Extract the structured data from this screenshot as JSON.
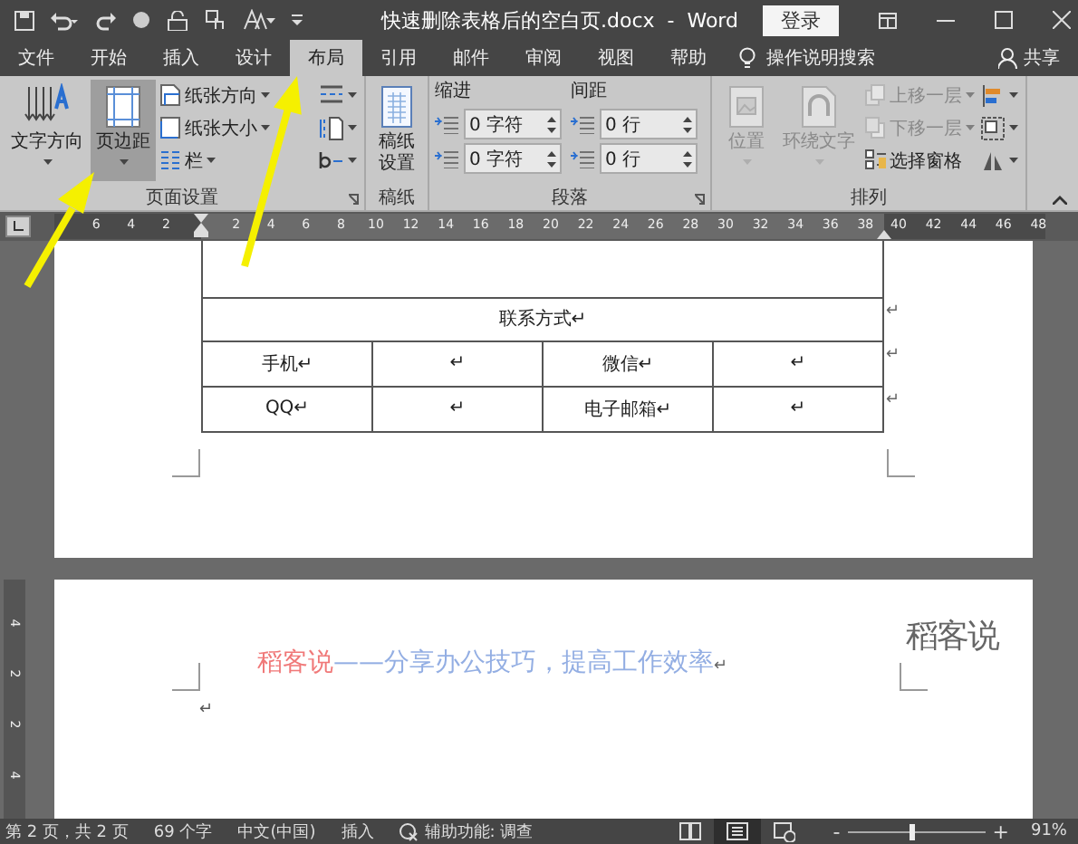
{
  "title_bar": {
    "title": "快速删除表格后的空白页.docx  -  Word",
    "login": "登录"
  },
  "tabs": [
    {
      "label": "文件",
      "selected": false
    },
    {
      "label": "开始",
      "selected": false
    },
    {
      "label": "插入",
      "selected": false
    },
    {
      "label": "设计",
      "selected": false
    },
    {
      "label": "布局",
      "selected": true
    },
    {
      "label": "引用",
      "selected": false
    },
    {
      "label": "邮件",
      "selected": false
    },
    {
      "label": "审阅",
      "selected": false
    },
    {
      "label": "视图",
      "selected": false
    },
    {
      "label": "帮助",
      "selected": false
    }
  ],
  "tell_me": "操作说明搜索",
  "share": "共享",
  "ribbon": {
    "groups": [
      {
        "label": "页面设置",
        "launcher": true,
        "controls": [
          {
            "kind": "large",
            "label": "文字方向",
            "dropdown": true,
            "hovered": false,
            "disabled": false
          },
          {
            "kind": "large",
            "label": "页边距",
            "dropdown": true,
            "hovered": true,
            "disabled": false
          },
          {
            "kind": "small",
            "label": "纸张方向",
            "dropdown": true,
            "hovered": false,
            "disabled": false
          },
          {
            "kind": "small",
            "label": "纸张大小",
            "dropdown": true,
            "hovered": false,
            "disabled": false
          },
          {
            "kind": "small",
            "label": "栏",
            "dropdown": true,
            "hovered": false,
            "disabled": false
          },
          {
            "kind": "icon",
            "dropdown": true,
            "hovered": false,
            "disabled": false
          },
          {
            "kind": "icon",
            "dropdown": true,
            "hovered": false,
            "disabled": false
          },
          {
            "kind": "icon",
            "dropdown": true,
            "hovered": false,
            "disabled": false
          }
        ]
      },
      {
        "label": "稿纸",
        "launcher": false,
        "controls": [
          {
            "kind": "large",
            "label": "稿纸设置",
            "dropdown": false,
            "hovered": false,
            "disabled": false
          }
        ]
      },
      {
        "label": "段落",
        "launcher": true,
        "controls": [
          {
            "kind": "spinners",
            "label": "缩进",
            "values": [
              "0 字符",
              "0 字符"
            ],
            "hovered": false,
            "disabled": false
          },
          {
            "kind": "spinners",
            "label": "间距",
            "values": [
              "0 行",
              "0 行"
            ],
            "hovered": false,
            "disabled": false
          }
        ]
      },
      {
        "label": "排列",
        "launcher": false,
        "controls": [
          {
            "kind": "large",
            "label": "位置",
            "dropdown": true,
            "hovered": false,
            "disabled": true
          },
          {
            "kind": "large",
            "label": "环绕文字",
            "dropdown": true,
            "hovered": false,
            "disabled": true
          },
          {
            "kind": "small",
            "label": "上移一层",
            "dropdown": true,
            "hovered": false,
            "disabled": true
          },
          {
            "kind": "small",
            "label": "下移一层",
            "dropdown": true,
            "hovered": false,
            "disabled": true
          },
          {
            "kind": "small",
            "label": "选择窗格",
            "dropdown": false,
            "hovered": false,
            "disabled": false
          },
          {
            "kind": "icon",
            "dropdown": true,
            "hovered": false,
            "disabled": false
          },
          {
            "kind": "icon",
            "dropdown": true,
            "hovered": false,
            "disabled": false
          },
          {
            "kind": "icon",
            "dropdown": true,
            "hovered": false,
            "disabled": false
          }
        ]
      }
    ]
  },
  "ruler": {
    "left_margin_ticks": [
      "6",
      "4",
      "2"
    ],
    "text_ticks": [
      "2",
      "4",
      "6",
      "8",
      "10",
      "12",
      "14",
      "16",
      "18",
      "20",
      "22",
      "24",
      "26",
      "28",
      "30",
      "32",
      "34",
      "36",
      "38"
    ],
    "right_margin_ticks": [
      "40",
      "42",
      "44",
      "46",
      "48"
    ]
  },
  "vertical_ruler": [
    "4",
    "2",
    "2",
    "4"
  ],
  "table": {
    "rows": [
      {
        "kind": "blank"
      },
      {
        "kind": "merged",
        "cells": [
          "联系方式↵"
        ],
        "end_mark": "↵"
      },
      {
        "kind": "normal",
        "cells": [
          "手机↵",
          "↵",
          "微信↵",
          "↵"
        ],
        "end_mark": "↵"
      },
      {
        "kind": "normal",
        "cells": [
          "QQ↵",
          "↵",
          "电子邮箱↵",
          "↵"
        ],
        "end_mark": "↵"
      }
    ]
  },
  "page2": {
    "heading": [
      {
        "text": "稻客说",
        "color": "#f07878"
      },
      {
        "text": "——分享办公技巧，提高工作效率",
        "color": "#93aee3"
      }
    ],
    "heading_mark": "↵",
    "logo": "稻客说",
    "paragraph_mark": "↵"
  },
  "status_bar": {
    "items": [
      "第 2 页，共 2 页",
      "69 个字",
      "中文(中国)",
      "插入"
    ],
    "accessibility": "辅助功能: 调查",
    "views": [
      {
        "selected": false
      },
      {
        "selected": true
      },
      {
        "selected": false
      }
    ],
    "zoom": {
      "minus": "-",
      "plus": "+",
      "level": 0.46,
      "reading": "91%"
    }
  }
}
